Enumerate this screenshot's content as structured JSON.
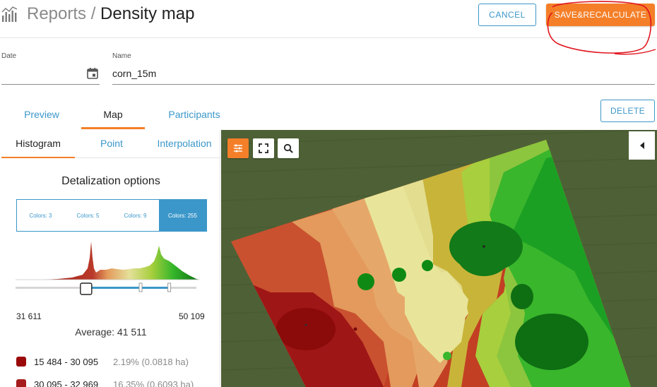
{
  "header": {
    "title_prefix": "Reports / ",
    "title": "Density map",
    "cancel_label": "CANCEL",
    "save_label": "SAVE&RECALCULATE"
  },
  "form": {
    "date_label": "Date",
    "date_value": "",
    "name_label": "Name",
    "name_value": "corn_15m"
  },
  "tabs": [
    {
      "label": "Preview"
    },
    {
      "label": "Map"
    },
    {
      "label": "Participants"
    }
  ],
  "delete_label": "DELETE",
  "panel": {
    "subtabs": [
      {
        "label": "Histogram"
      },
      {
        "label": "Point"
      },
      {
        "label": "Interpolation"
      }
    ],
    "detalization_title": "Detalization options",
    "color_options": [
      {
        "label": "Colors: 3"
      },
      {
        "label": "Colors: 5"
      },
      {
        "label": "Colors: 9"
      },
      {
        "label": "Colors: 255"
      }
    ],
    "selected_color_option": 3,
    "range_min": "31 611",
    "range_max": "50 109",
    "average": "Average: 41 511",
    "slider_low_fraction": 0.39,
    "slider_high_fraction": 0.85,
    "legend": [
      {
        "range": "15 484 - 30 095",
        "pct": "2.19% (0.0818 ha)",
        "color": "#9b0a0a"
      },
      {
        "range": "30 095 - 32 969",
        "pct": "16.35% (0.6093 ha)",
        "color": "#a41c1c"
      }
    ]
  },
  "colors": {
    "accent": "#f47f28",
    "link": "#3b97c9"
  }
}
